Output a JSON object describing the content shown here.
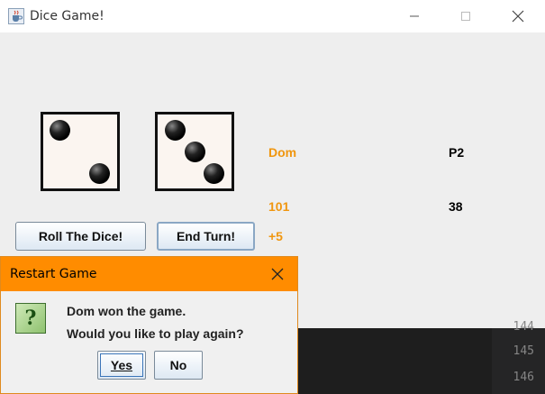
{
  "window": {
    "title": "Dice Game!"
  },
  "icons": {
    "app": "java-cup-icon",
    "minimize": "minimize-icon",
    "maximize": "maximize-icon",
    "close": "close-icon",
    "question": "question-icon"
  },
  "dice": [
    {
      "face": 2
    },
    {
      "face": 3
    }
  ],
  "buttons": {
    "roll": "Roll The Dice!",
    "end_turn": "End Turn!"
  },
  "players": [
    {
      "name": "Dom",
      "score": "101",
      "turn_points": "+5",
      "color": "#f0960f"
    },
    {
      "name": "P2",
      "score": "38",
      "color": "#000000"
    }
  ],
  "terminal": {
    "line_numbers": [
      "144",
      "145",
      "146"
    ]
  },
  "dialog": {
    "title": "Restart Game",
    "message_line1": "Dom won the game.",
    "message_line2": "Would you like to play again?",
    "yes_label": "Yes",
    "no_label": "No",
    "title_color": "#ff8c00"
  }
}
